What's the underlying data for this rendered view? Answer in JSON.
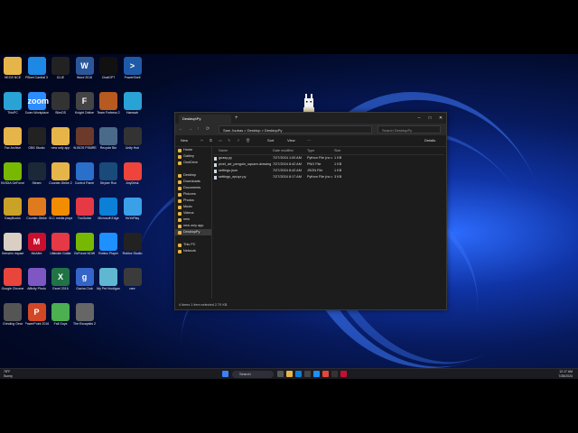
{
  "desktop": {
    "icons": [
      {
        "label": "HEOS NCE",
        "icon": "folder-icon",
        "color": "#e6b54a",
        "text": ""
      },
      {
        "label": "PBnet Cardtal 3",
        "icon": "app-icon",
        "color": "#1e88e5",
        "text": ""
      },
      {
        "label": "iCUE",
        "icon": "icue-icon",
        "color": "#222",
        "text": ""
      },
      {
        "label": "Word 2016",
        "icon": "word-icon",
        "color": "#2b579a",
        "text": "W"
      },
      {
        "label": "ChatGPT",
        "icon": "chatgpt-icon",
        "color": "#111",
        "text": ""
      },
      {
        "label": "PowerShell",
        "icon": "powershell-icon",
        "color": "#1e5aa8",
        "text": ">"
      },
      {
        "label": "ThisPC",
        "icon": "monitor-icon",
        "color": "#29a3d6",
        "text": ""
      },
      {
        "label": "Zoom Workplace",
        "icon": "zoom-icon",
        "color": "#2d8cff",
        "text": "zoom"
      },
      {
        "label": "SlimOS",
        "icon": "app-icon",
        "color": "#333",
        "text": ""
      },
      {
        "label": "Knight Online",
        "icon": "game-icon",
        "color": "#444",
        "text": "F"
      },
      {
        "label": "Team Fortress 2",
        "icon": "tf2-icon",
        "color": "#b65a1f",
        "text": ""
      },
      {
        "label": "Hamsah",
        "icon": "monitor-icon",
        "color": "#29a3d6",
        "text": ""
      },
      {
        "label": "Fax Archive",
        "icon": "folder-icon",
        "color": "#e6b54a",
        "text": ""
      },
      {
        "label": "OBS Studio",
        "icon": "obs-icon",
        "color": "#222",
        "text": ""
      },
      {
        "label": "new only app",
        "icon": "folder-icon",
        "color": "#e6b54a",
        "text": ""
      },
      {
        "label": "HLISOS PSMREG",
        "icon": "game-icon",
        "color": "#6b3a2a",
        "text": ""
      },
      {
        "label": "Recycle Bin",
        "icon": "recycle-bin-icon",
        "color": "#4a6a8a",
        "text": ""
      },
      {
        "label": "Unity Hub",
        "icon": "unity-icon",
        "color": "#333",
        "text": ""
      },
      {
        "label": "NVIDIA GeForce",
        "icon": "nvidia-icon",
        "color": "#76b900",
        "text": ""
      },
      {
        "label": "Steam",
        "icon": "steam-icon",
        "color": "#1b2838",
        "text": ""
      },
      {
        "label": "Counter-Strike 2",
        "icon": "folder-icon",
        "color": "#e6b54a",
        "text": ""
      },
      {
        "label": "Control Panel",
        "icon": "control-panel-icon",
        "color": "#2a6fc9",
        "text": ""
      },
      {
        "label": "Stryker Run",
        "icon": "game-icon",
        "color": "#1a4a7a",
        "text": ""
      },
      {
        "label": "AnyDesk",
        "icon": "anydesk-icon",
        "color": "#ef443b",
        "text": ""
      },
      {
        "label": "EasyBooks",
        "icon": "game-icon",
        "color": "#c9a227",
        "text": ""
      },
      {
        "label": "Counter-Strike",
        "icon": "cs-icon",
        "color": "#e07a1f",
        "text": ""
      },
      {
        "label": "VLC media player",
        "icon": "vlc-icon",
        "color": "#f28c00",
        "text": ""
      },
      {
        "label": "TuxGuitar",
        "icon": "app-icon",
        "color": "#e53945",
        "text": ""
      },
      {
        "label": "Microsoft Edge",
        "icon": "edge-icon",
        "color": "#0c7fd6",
        "text": ""
      },
      {
        "label": "HoYoPlay",
        "icon": "app-icon",
        "color": "#3aa0e8",
        "text": ""
      },
      {
        "label": "Genshin Impact",
        "icon": "game-icon",
        "color": "#d9cfc2",
        "text": ""
      },
      {
        "label": "McAfee",
        "icon": "mcafee-icon",
        "color": "#c8102e",
        "text": "M"
      },
      {
        "label": "Ultimate Guitar",
        "icon": "app-icon",
        "color": "#e53945",
        "text": ""
      },
      {
        "label": "GeForce NOW",
        "icon": "nvidia-icon",
        "color": "#76b900",
        "text": ""
      },
      {
        "label": "Roblox Player",
        "icon": "roblox-icon",
        "color": "#1e90ff",
        "text": ""
      },
      {
        "label": "Roblox Studio",
        "icon": "roblox-icon",
        "color": "#222",
        "text": ""
      },
      {
        "label": "Google Chrome",
        "icon": "chrome-icon",
        "color": "#e8453c",
        "text": ""
      },
      {
        "label": "Affinity Photo",
        "icon": "app-icon",
        "color": "#7e57c2",
        "text": ""
      },
      {
        "label": "Excel 2016",
        "icon": "excel-icon",
        "color": "#217346",
        "text": "X"
      },
      {
        "label": "Gacha Club",
        "icon": "app-icon",
        "color": "#3565c9",
        "text": "g"
      },
      {
        "label": "My Pet Hooligan",
        "icon": "game-icon",
        "color": "#5fb8d0",
        "text": ""
      },
      {
        "label": "rare",
        "icon": "app-icon",
        "color": "#3b3b3b",
        "text": ""
      },
      {
        "label": "Grinding Gear",
        "icon": "app-icon",
        "color": "#555",
        "text": ""
      },
      {
        "label": "PowerPoint 2016",
        "icon": "powerpoint-icon",
        "color": "#d24726",
        "text": "P"
      },
      {
        "label": "Fall Guys",
        "icon": "game-icon",
        "color": "#4caf50",
        "text": ""
      },
      {
        "label": "The Escapists 2",
        "icon": "game-icon",
        "color": "#666",
        "text": ""
      }
    ]
  },
  "explorer": {
    "tab_title": "Desktop\\Py",
    "address": "Sam Joubas  >  Desktop  >  DesktopPy",
    "search_placeholder": "Search DesktopPy",
    "nav_back": "←",
    "nav_forward": "→",
    "nav_up": "↑",
    "nav_refresh": "⟳",
    "cmd": {
      "new": "New",
      "sort": "Sort",
      "view": "View",
      "more": "···",
      "details": "Details"
    },
    "nav_items": [
      "Home",
      "Gallery",
      "OneDrive",
      "",
      "Desktop",
      "Downloads",
      "Documents",
      "Pictures",
      "Photos",
      "Music",
      "Videos",
      "new",
      "new only app",
      "DesktopPy",
      "",
      "This PC",
      "Network"
    ],
    "selected_nav": 13,
    "columns": {
      "name": "Name",
      "date": "Date modified",
      "type": "Type",
      "size": "Size"
    },
    "files": [
      {
        "name": "guasy.py",
        "date": "7/27/2024 1:00 AM",
        "type": "Python File (no co...",
        "size": "1 KB"
      },
      {
        "name": "pixel_art_penguin_square-drawing.png",
        "date": "7/27/2024 8:42 AM",
        "type": "PNG File",
        "size": "1 KB"
      },
      {
        "name": "settings.json",
        "date": "7/27/2024 8:42 AM",
        "type": "JSON File",
        "size": "1 KB"
      },
      {
        "name": "settings_epuyx.py",
        "date": "7/27/2024 8:17 AM",
        "type": "Python File (no co...",
        "size": "3 KB"
      }
    ],
    "status": "4 items    1 item selected 2.70 KB"
  },
  "taskbar": {
    "search_label": "Search",
    "weather": "78°F",
    "weather_sub": "Sunny",
    "time": "12:17 AM",
    "date": "7/28/2024"
  }
}
